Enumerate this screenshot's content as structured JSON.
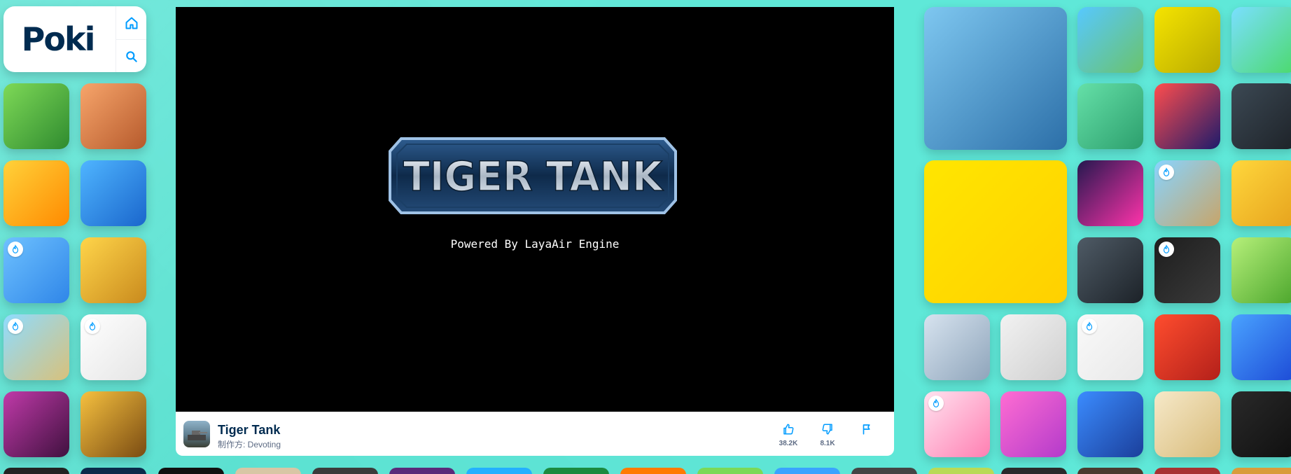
{
  "logo": {
    "text": "Poki"
  },
  "nav": {
    "home_label": "home-icon",
    "search_label": "search-icon"
  },
  "game": {
    "title": "Tiger Tank",
    "developer": "制作方: Devoting",
    "splash_title": "TIGER TANK",
    "powered_by": "Powered By LayaAir Engine",
    "likes": "38.2K",
    "dislikes": "8.1K"
  },
  "tiles_left": [
    {
      "name": "tank-game-tile",
      "colors": [
        "#7ed957",
        "#2f8b2f"
      ]
    },
    {
      "name": "jet-game-tile",
      "colors": [
        "#f7a56b",
        "#b65a2c"
      ]
    },
    {
      "name": "ping-pong-tile",
      "colors": [
        "#ffd23a",
        "#ff8a00"
      ]
    },
    {
      "name": "soldier-game-tile",
      "colors": [
        "#4fb5ff",
        "#1a66cc"
      ]
    },
    {
      "name": "draw-line-tile",
      "colors": [
        "#6ec1ff",
        "#2f86e8"
      ]
    },
    {
      "name": "angry-viking-tile",
      "colors": [
        "#ffd54a",
        "#c98a1d"
      ]
    },
    {
      "name": "fishing-game-tile",
      "colors": [
        "#8fdcff",
        "#d8c17b"
      ]
    },
    {
      "name": "color-fill-tile",
      "colors": [
        "#ffffff",
        "#e5e5e5"
      ]
    },
    {
      "name": "skull-game-tile",
      "colors": [
        "#c03aa9",
        "#40113f"
      ]
    },
    {
      "name": "temple-run-tile",
      "colors": [
        "#f6c13f",
        "#7a4b12"
      ]
    }
  ],
  "tiles_right": [
    {
      "name": "pirate-ship-tile",
      "colors": [
        "#7ec7f0",
        "#2c6fa8"
      ]
    },
    {
      "name": "monster-truck-tile",
      "colors": [
        "#57c8ff",
        "#6ac36b"
      ]
    },
    {
      "name": "spike-jump-tile",
      "colors": [
        "#f5e400",
        "#b8aa00"
      ]
    },
    {
      "name": "cube-building-tile",
      "colors": [
        "#7adfff",
        "#4bd96b"
      ]
    },
    {
      "name": "runner-game-tile",
      "colors": [
        "#65e0a8",
        "#2c9f6d"
      ]
    },
    {
      "name": "racing-car-tile",
      "colors": [
        "#ff4d4d",
        "#1d1b6b"
      ]
    },
    {
      "name": "battleship-war-tile",
      "colors": [
        "#3c4954",
        "#1d2228"
      ]
    },
    {
      "name": "stickman-knight-tile",
      "colors": [
        "#ffe600",
        "#ffd000"
      ]
    },
    {
      "name": "drift-game-tile",
      "colors": [
        "#25184f",
        "#ff33aa"
      ]
    },
    {
      "name": "survival-island-tile",
      "colors": [
        "#88d4ff",
        "#c7a56a"
      ]
    },
    {
      "name": "stick-war-tile",
      "colors": [
        "#ffd73c",
        "#e6a21d"
      ]
    },
    {
      "name": "combat-reloaded-tile",
      "colors": [
        "#4f5b66",
        "#1c2228"
      ]
    },
    {
      "name": "marble-run-tile",
      "colors": [
        "#1d1d1d",
        "#3b3b3b"
      ]
    },
    {
      "name": "green-tank-tile",
      "colors": [
        "#b6f07a",
        "#4aa52b"
      ]
    },
    {
      "name": "viking-sword-tile",
      "colors": [
        "#d7e3ef",
        "#8fa5bb"
      ]
    },
    {
      "name": "stickman-gunner-tile",
      "colors": [
        "#f2f2f2",
        "#cfcfcf"
      ]
    },
    {
      "name": "paint-mix-tile",
      "colors": [
        "#fafafa",
        "#e8e8e8"
      ]
    },
    {
      "name": "spartan-warrior-tile",
      "colors": [
        "#ff4d2e",
        "#b3201a"
      ]
    },
    {
      "name": "punch-numbers-tile",
      "colors": [
        "#4aa3ff",
        "#1c4ad6"
      ]
    },
    {
      "name": "brain-allstar-tile",
      "colors": [
        "#ffe3f0",
        "#ff7fb2"
      ]
    },
    {
      "name": "falling-man-tile",
      "colors": [
        "#ff6dd2",
        "#b33acb"
      ]
    },
    {
      "name": "pirate-raft-tile",
      "colors": [
        "#3b8cff",
        "#1b3f9b"
      ]
    },
    {
      "name": "dice-game-tile",
      "colors": [
        "#f6e9c9",
        "#d8bb7a"
      ]
    },
    {
      "name": "cryzen-tile",
      "colors": [
        "#2a2a2a",
        "#0f0f0f"
      ]
    }
  ]
}
